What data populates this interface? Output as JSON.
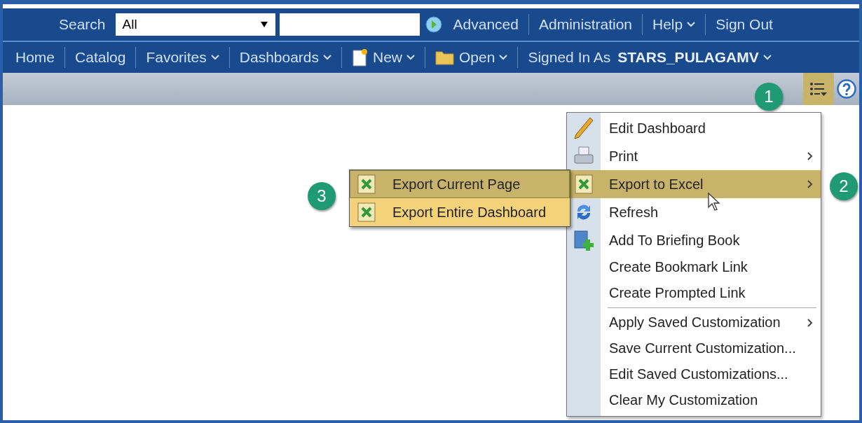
{
  "top_bar": {
    "search_label": "Search",
    "scope": "All",
    "links": [
      {
        "label": "Advanced",
        "dropdown": false
      },
      {
        "label": "Administration",
        "dropdown": false
      },
      {
        "label": "Help",
        "dropdown": true
      },
      {
        "label": "Sign Out",
        "dropdown": false
      }
    ]
  },
  "nav": {
    "items": [
      {
        "label": "Home",
        "dropdown": false,
        "kind": "plain"
      },
      {
        "label": "Catalog",
        "dropdown": false,
        "kind": "plain"
      },
      {
        "label": "Favorites",
        "dropdown": true,
        "kind": "plain"
      },
      {
        "label": "Dashboards",
        "dropdown": true,
        "kind": "plain"
      },
      {
        "label": "New",
        "dropdown": true,
        "kind": "new"
      },
      {
        "label": "Open",
        "dropdown": true,
        "kind": "open"
      }
    ],
    "signed_in_label": "Signed In As",
    "user": "STARS_PULAGAMV"
  },
  "toolbar": {
    "callout": "1"
  },
  "menu": {
    "callout": "2",
    "items": [
      {
        "label": "Edit Dashboard",
        "kind": "edit",
        "submenu": false,
        "selected": false,
        "divider_before": false
      },
      {
        "label": "Print",
        "kind": "print",
        "submenu": true,
        "selected": false,
        "divider_before": false
      },
      {
        "label": "Export to Excel",
        "kind": "export",
        "submenu": true,
        "selected": true,
        "divider_before": false
      },
      {
        "label": "Refresh",
        "kind": "refresh",
        "submenu": false,
        "selected": false,
        "divider_before": false
      },
      {
        "label": "Add To Briefing Book",
        "kind": "briefing",
        "submenu": false,
        "selected": false,
        "divider_before": false
      },
      {
        "label": "Create Bookmark Link",
        "kind": "plain",
        "submenu": false,
        "selected": false,
        "divider_before": false
      },
      {
        "label": "Create Prompted Link",
        "kind": "plain",
        "submenu": false,
        "selected": false,
        "divider_before": false
      },
      {
        "label": "Apply Saved Customization",
        "kind": "plain",
        "submenu": true,
        "selected": false,
        "divider_before": true
      },
      {
        "label": "Save Current Customization...",
        "kind": "plain",
        "submenu": false,
        "selected": false,
        "divider_before": false
      },
      {
        "label": "Edit Saved Customizations...",
        "kind": "plain",
        "submenu": false,
        "selected": false,
        "divider_before": false
      },
      {
        "label": "Clear My Customization",
        "kind": "plain",
        "submenu": false,
        "selected": false,
        "divider_before": false
      }
    ]
  },
  "submenu": {
    "callout": "3",
    "items": [
      {
        "label": "Export Current Page",
        "selected": true
      },
      {
        "label": "Export Entire Dashboard",
        "selected": false
      }
    ]
  }
}
